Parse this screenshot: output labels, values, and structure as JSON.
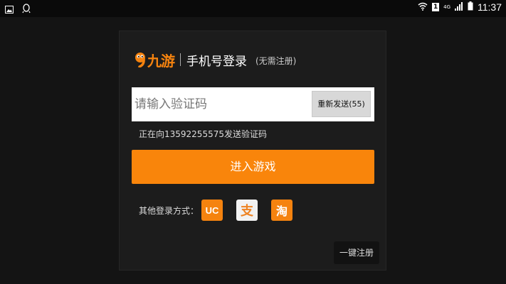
{
  "status_bar": {
    "sim_label": "1",
    "network_label": "4G",
    "time": "11:37"
  },
  "dialog": {
    "logo_text": "九游",
    "title": "手机号登录",
    "subtitle": "(无需注册)",
    "code_placeholder": "请输入验证码",
    "resend_label": "重新发送(55)",
    "hint": "正在向13592255575发送验证码",
    "enter_label": "进入游戏",
    "other_login_label": "其他登录方式：",
    "other_logins": [
      {
        "name": "uc",
        "label": "UC"
      },
      {
        "name": "alipay",
        "label": "支"
      },
      {
        "name": "taobao",
        "label": "淘"
      }
    ],
    "register_label": "一键注册"
  },
  "colors": {
    "accent": "#f9850b",
    "background": "#141414",
    "dialog": "#1c1c1c"
  }
}
